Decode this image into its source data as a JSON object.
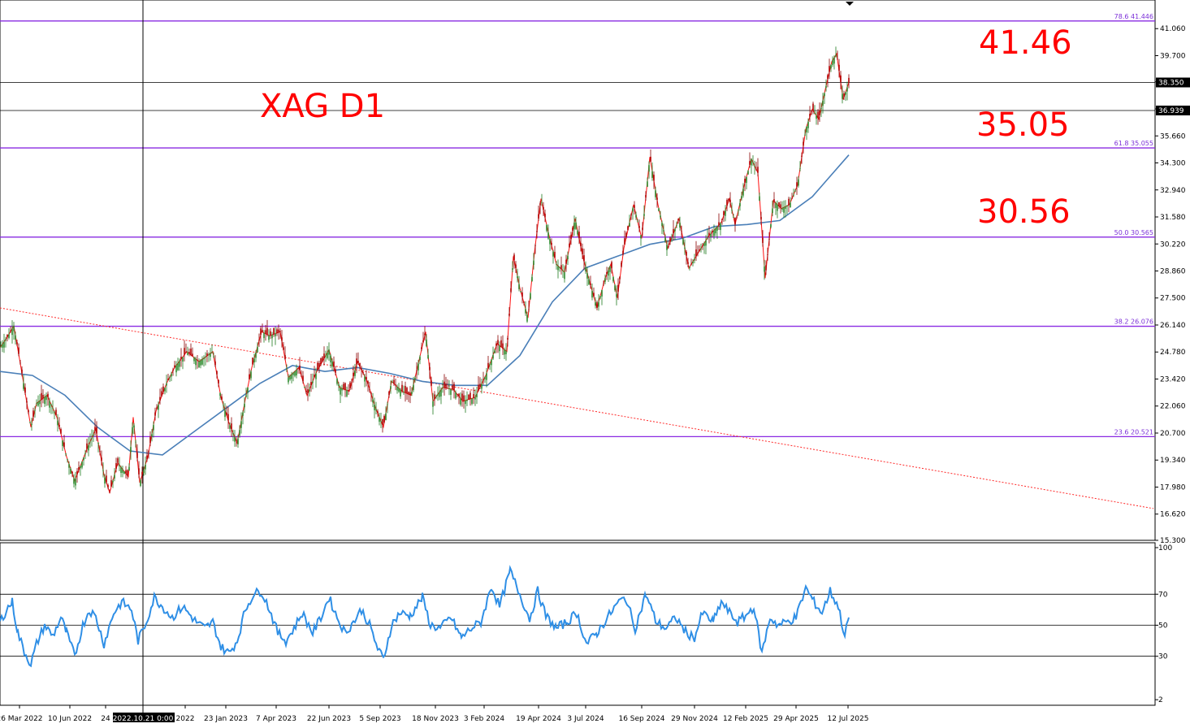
{
  "chart_data": [
    {
      "type": "candlestick",
      "title": "XAG D1",
      "price_axis": {
        "ylim": [
          15.3,
          42.42
        ],
        "ticks": [
          "15.300",
          "16.620",
          "17.980",
          "19.340",
          "20.700",
          "22.060",
          "23.420",
          "24.780",
          "26.140",
          "27.500",
          "28.860",
          "30.220",
          "31.580",
          "32.940",
          "34.300",
          "35.660",
          "37.020",
          "38.380",
          "39.700",
          "41.060"
        ]
      },
      "markers": [
        {
          "label": "38.350",
          "value": 38.35,
          "style": "black-line-with-tag"
        },
        {
          "label": "36.939",
          "value": 36.939,
          "style": "black-line-with-tag"
        }
      ],
      "fib_levels": [
        {
          "label": "78.6 41.446",
          "value": 41.446
        },
        {
          "label": "61.8 35.055",
          "value": 35.055
        },
        {
          "label": "50.0 30.565",
          "value": 30.565
        },
        {
          "label": "38.2 26.076",
          "value": 26.076
        },
        {
          "label": "23.6 20.521",
          "value": 20.521
        }
      ],
      "annotations": [
        "41.46",
        "35.05",
        "30.56"
      ],
      "x_ticks": [
        "26 Mar 2022",
        "10 Jun 2022",
        "24",
        "2022.10.21 0:00",
        "2022",
        "23 Jan 2023",
        "7 Apr 2023",
        "22 Jun 2023",
        "5 Sep 2023",
        "18 Nov 2023",
        "3 Feb 2024",
        "19 Apr 2024",
        "3 Jul 2024",
        "16 Sep 2024",
        "29 Nov 2024",
        "12 Feb 2025",
        "29 Apr 2025",
        "12 Jul 2025"
      ],
      "price_path": [
        [
          0,
          25.0
        ],
        [
          10,
          25.6
        ],
        [
          17,
          26.1
        ],
        [
          25,
          24.2
        ],
        [
          38,
          21.0
        ],
        [
          45,
          22.2
        ],
        [
          58,
          22.6
        ],
        [
          70,
          21.5
        ],
        [
          82,
          19.5
        ],
        [
          92,
          18.3
        ],
        [
          108,
          20.0
        ],
        [
          118,
          20.9
        ],
        [
          128,
          18.6
        ],
        [
          135,
          17.7
        ],
        [
          145,
          19.2
        ],
        [
          158,
          18.5
        ],
        [
          164,
          21.5
        ],
        [
          172,
          18.2
        ],
        [
          182,
          19.5
        ],
        [
          192,
          21.8
        ],
        [
          205,
          23.2
        ],
        [
          215,
          24.0
        ],
        [
          230,
          24.8
        ],
        [
          245,
          24.3
        ],
        [
          262,
          24.8
        ],
        [
          272,
          22.5
        ],
        [
          282,
          21.2
        ],
        [
          292,
          20.2
        ],
        [
          302,
          22.4
        ],
        [
          310,
          24.0
        ],
        [
          322,
          25.8
        ],
        [
          332,
          25.6
        ],
        [
          345,
          25.8
        ],
        [
          355,
          23.5
        ],
        [
          368,
          24.0
        ],
        [
          378,
          22.6
        ],
        [
          390,
          23.8
        ],
        [
          405,
          24.9
        ],
        [
          418,
          23.0
        ],
        [
          430,
          22.8
        ],
        [
          440,
          24.3
        ],
        [
          452,
          23.3
        ],
        [
          462,
          22.0
        ],
        [
          472,
          21.0
        ],
        [
          482,
          23.3
        ],
        [
          495,
          22.8
        ],
        [
          506,
          22.6
        ],
        [
          515,
          24.2
        ],
        [
          524,
          25.8
        ],
        [
          533,
          22.3
        ],
        [
          545,
          23.0
        ],
        [
          558,
          22.9
        ],
        [
          570,
          22.3
        ],
        [
          585,
          22.5
        ],
        [
          598,
          23.6
        ],
        [
          612,
          25.2
        ],
        [
          624,
          24.8
        ],
        [
          632,
          29.6
        ],
        [
          640,
          28.0
        ],
        [
          650,
          26.5
        ],
        [
          658,
          29.8
        ],
        [
          666,
          32.5
        ],
        [
          675,
          30.8
        ],
        [
          685,
          29.2
        ],
        [
          695,
          28.8
        ],
        [
          708,
          31.5
        ],
        [
          718,
          29.5
        ],
        [
          728,
          28.0
        ],
        [
          735,
          27.0
        ],
        [
          745,
          28.5
        ],
        [
          752,
          29.2
        ],
        [
          760,
          27.5
        ],
        [
          768,
          30.0
        ],
        [
          780,
          32.2
        ],
        [
          790,
          30.5
        ],
        [
          800,
          34.6
        ],
        [
          810,
          32.2
        ],
        [
          822,
          30.0
        ],
        [
          836,
          31.5
        ],
        [
          848,
          29.0
        ],
        [
          860,
          29.8
        ],
        [
          872,
          30.6
        ],
        [
          888,
          31.3
        ],
        [
          898,
          32.5
        ],
        [
          905,
          31.2
        ],
        [
          915,
          33.0
        ],
        [
          925,
          34.5
        ],
        [
          933,
          33.8
        ],
        [
          942,
          28.5
        ],
        [
          952,
          32.4
        ],
        [
          962,
          32.0
        ],
        [
          972,
          32.2
        ],
        [
          982,
          33.2
        ],
        [
          992,
          36.0
        ],
        [
          1000,
          37.0
        ],
        [
          1008,
          36.5
        ],
        [
          1016,
          38.0
        ],
        [
          1024,
          39.4
        ],
        [
          1030,
          39.8
        ],
        [
          1038,
          37.5
        ],
        [
          1045,
          38.35
        ]
      ],
      "ma_path": [
        [
          0,
          23.8
        ],
        [
          40,
          23.6
        ],
        [
          80,
          22.6
        ],
        [
          120,
          21.0
        ],
        [
          160,
          19.8
        ],
        [
          200,
          19.6
        ],
        [
          240,
          20.8
        ],
        [
          280,
          22.0
        ],
        [
          320,
          23.2
        ],
        [
          360,
          24.1
        ],
        [
          400,
          23.8
        ],
        [
          440,
          24.0
        ],
        [
          480,
          23.7
        ],
        [
          520,
          23.3
        ],
        [
          560,
          23.1
        ],
        [
          600,
          23.1
        ],
        [
          640,
          24.6
        ],
        [
          680,
          27.3
        ],
        [
          720,
          29.0
        ],
        [
          760,
          29.6
        ],
        [
          800,
          30.2
        ],
        [
          840,
          30.5
        ],
        [
          880,
          31.1
        ],
        [
          920,
          31.2
        ],
        [
          960,
          31.4
        ],
        [
          1000,
          32.6
        ],
        [
          1045,
          34.7
        ]
      ],
      "trendline": {
        "from": [
          0,
          27.0
        ],
        "to": [
          1420,
          16.9
        ]
      }
    },
    {
      "type": "line",
      "title": "",
      "ylim": [
        0,
        100
      ],
      "ticks": [
        "100",
        "70",
        "50",
        "30",
        "2"
      ],
      "levels": [
        70,
        50,
        30
      ],
      "series": [
        {
          "values": [
            [
              0,
              52
            ],
            [
              8,
              60
            ],
            [
              15,
              65
            ],
            [
              22,
              45
            ],
            [
              30,
              33
            ],
            [
              38,
              25
            ],
            [
              45,
              38
            ],
            [
              55,
              50
            ],
            [
              65,
              43
            ],
            [
              75,
              55
            ],
            [
              82,
              45
            ],
            [
              92,
              30
            ],
            [
              102,
              50
            ],
            [
              110,
              60
            ],
            [
              118,
              55
            ],
            [
              128,
              38
            ],
            [
              140,
              58
            ],
            [
              150,
              65
            ],
            [
              162,
              60
            ],
            [
              170,
              40
            ],
            [
              180,
              52
            ],
            [
              190,
              68
            ],
            [
              200,
              62
            ],
            [
              212,
              55
            ],
            [
              225,
              62
            ],
            [
              240,
              53
            ],
            [
              252,
              48
            ],
            [
              262,
              52
            ],
            [
              272,
              36
            ],
            [
              282,
              32
            ],
            [
              292,
              40
            ],
            [
              302,
              60
            ],
            [
              312,
              70
            ],
            [
              322,
              72
            ],
            [
              332,
              60
            ],
            [
              342,
              45
            ],
            [
              352,
              40
            ],
            [
              362,
              48
            ],
            [
              372,
              58
            ],
            [
              385,
              45
            ],
            [
              395,
              55
            ],
            [
              405,
              68
            ],
            [
              415,
              55
            ],
            [
              425,
              45
            ],
            [
              435,
              52
            ],
            [
              445,
              60
            ],
            [
              455,
              50
            ],
            [
              465,
              35
            ],
            [
              472,
              28
            ],
            [
              482,
              50
            ],
            [
              492,
              58
            ],
            [
              505,
              56
            ],
            [
              520,
              68
            ],
            [
              530,
              50
            ],
            [
              542,
              48
            ],
            [
              555,
              55
            ],
            [
              568,
              42
            ],
            [
              580,
              48
            ],
            [
              592,
              52
            ],
            [
              605,
              75
            ],
            [
              615,
              62
            ],
            [
              628,
              85
            ],
            [
              640,
              70
            ],
            [
              652,
              54
            ],
            [
              662,
              72
            ],
            [
              672,
              56
            ],
            [
              685,
              48
            ],
            [
              698,
              52
            ],
            [
              710,
              58
            ],
            [
              722,
              38
            ],
            [
              735,
              45
            ],
            [
              748,
              55
            ],
            [
              760,
              64
            ],
            [
              770,
              68
            ],
            [
              782,
              48
            ],
            [
              795,
              70
            ],
            [
              808,
              52
            ],
            [
              820,
              48
            ],
            [
              832,
              55
            ],
            [
              845,
              45
            ],
            [
              855,
              42
            ],
            [
              865,
              58
            ],
            [
              878,
              52
            ],
            [
              888,
              65
            ],
            [
              898,
              58
            ],
            [
              908,
              52
            ],
            [
              918,
              56
            ],
            [
              928,
              62
            ],
            [
              938,
              32
            ],
            [
              948,
              55
            ],
            [
              958,
              50
            ],
            [
              968,
              52
            ],
            [
              980,
              55
            ],
            [
              992,
              74
            ],
            [
              1002,
              65
            ],
            [
              1012,
              58
            ],
            [
              1022,
              72
            ],
            [
              1032,
              62
            ],
            [
              1040,
              43
            ],
            [
              1045,
              55
            ]
          ]
        }
      ]
    }
  ]
}
